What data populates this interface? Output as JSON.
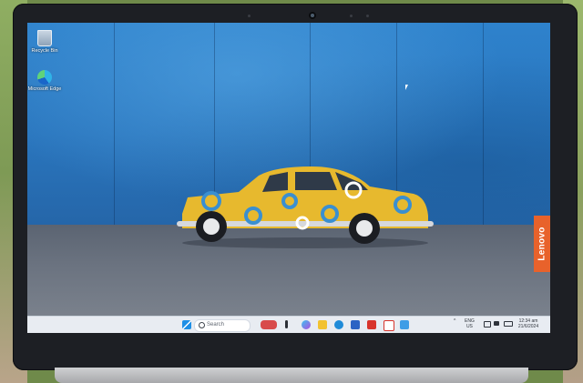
{
  "desktop": {
    "icons": [
      {
        "label": "Recycle Bin"
      },
      {
        "label": "Microsoft Edge"
      }
    ],
    "brand_tab": "Lenovo"
  },
  "taskbar": {
    "search_placeholder": "Search",
    "pinned_icons": [
      "car-widget-icon",
      "task-view-icon",
      "copilot-icon",
      "file-explorer-icon",
      "edge-icon",
      "store-icon",
      "app-red-icon",
      "mcafee-icon",
      "photos-icon"
    ],
    "tray": {
      "language_top": "ENG",
      "language_bottom": "US",
      "time": "12:34 am",
      "date": "21/6/2024"
    }
  },
  "colors": {
    "wall": "#2d7fc9",
    "car": "#e7b92e",
    "brand": "#e8622b",
    "taskbar": "#e8ecf2"
  }
}
